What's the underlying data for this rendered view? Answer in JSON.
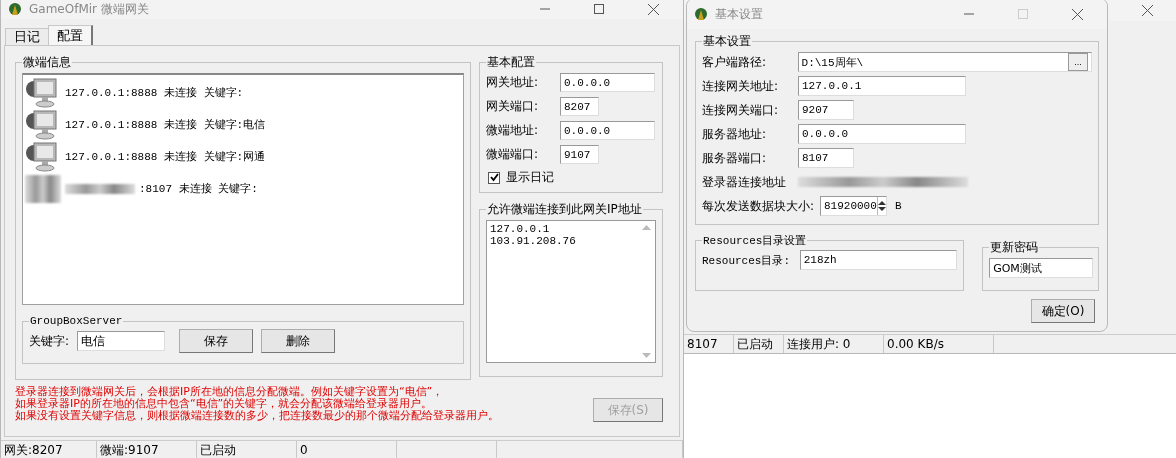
{
  "main_window": {
    "title": "GameOfMir 微端网关",
    "tabs": [
      {
        "label": "日记",
        "selected": false
      },
      {
        "label": "配置",
        "selected": true
      }
    ],
    "clients_group": {
      "title": "微端信息",
      "items": [
        {
          "text": "127.0.0.1:8888 未连接 关键字:",
          "redacted": false
        },
        {
          "text": "127.0.0.1:8888 未连接 关键字:电信",
          "redacted": false
        },
        {
          "text": "127.0.0.1:8888 未连接 关键字:网通",
          "redacted": false
        },
        {
          "text": ":8107 未连接 关键字:",
          "redacted": true
        }
      ]
    },
    "keyword_group": {
      "title": "GroupBoxServer",
      "label": "关键字:",
      "value": "电信",
      "buttons": [
        "保存",
        "删除"
      ]
    },
    "basic_config": {
      "title": "基本配置",
      "fields": [
        {
          "label": "网关地址:",
          "value": "0.0.0.0",
          "kind": "address"
        },
        {
          "label": "网关端口:",
          "value": "8207",
          "kind": "port"
        },
        {
          "label": "微端地址:",
          "value": "0.0.0.0",
          "kind": "address"
        },
        {
          "label": "微端端口:",
          "value": "9107",
          "kind": "port"
        }
      ],
      "show_log": {
        "label": "显示日记",
        "checked": true
      }
    },
    "allowed_ips": {
      "title": "允许微端连接到此网关IP地址",
      "lines": [
        "127.0.0.1",
        "103.91.208.76"
      ]
    },
    "notes": [
      "登录器连接到微端网关后，会根据IP所在地的信息分配微端。例如关键字设置为“电信”，",
      "如果登录器IP的所在地的信息中包含“电信”的关键字，就会分配该微端给登录器用户。",
      "如果没有设置关键字信息，则根据微端连接数的多少，把连接数最少的那个微端分配给登录器用户。"
    ],
    "save_button": {
      "label": "保存(S)",
      "disabled": true
    },
    "status_bar": [
      "网关:8207",
      "微端:9107",
      "已启动",
      "0"
    ]
  },
  "background_window": {
    "status_bar": [
      "8107",
      "已启动",
      "连接用户: 0",
      "0.00 KB/s"
    ]
  },
  "dialog": {
    "title": "基本设置",
    "settings_group": {
      "title": "基本设置",
      "rows": [
        {
          "label": "客户端路径:",
          "value": "D:\\15周年\\",
          "kind": "path",
          "button": "..."
        },
        {
          "label": "连接网关地址:",
          "value": "127.0.0.1",
          "kind": "address"
        },
        {
          "label": "连接网关端口:",
          "value": "9207",
          "kind": "port"
        },
        {
          "label": "服务器地址:",
          "value": "0.0.0.0",
          "kind": "address"
        },
        {
          "label": "服务器端口:",
          "value": "8107",
          "kind": "port"
        },
        {
          "label": "登录器连接地址",
          "kind": "redacted"
        },
        {
          "label": "每次发送数据块大小:",
          "value": "81920000",
          "kind": "spin",
          "unit": "B"
        }
      ]
    },
    "resources_group": {
      "title": "Resources目录设置",
      "label": "Resources目录:",
      "value": "218zh"
    },
    "password_group": {
      "title": "更新密码",
      "value": "GOM测试"
    },
    "ok_button": "确定(O)"
  }
}
